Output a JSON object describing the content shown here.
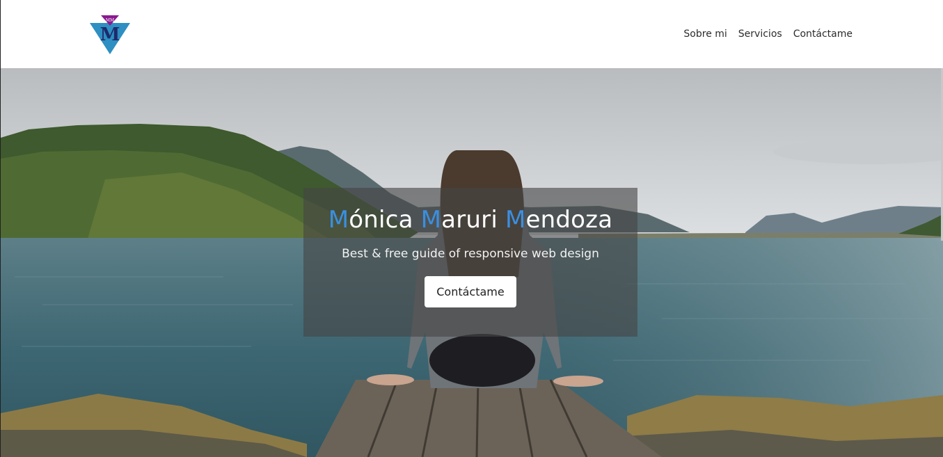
{
  "brand": {
    "logo_initials": "MM",
    "logo_letter": "M",
    "colors": {
      "triangle": "#2e8fc2",
      "top_triangle": "#8a1a8f",
      "letter": "#1d2a6b"
    }
  },
  "nav": {
    "items": [
      {
        "label": "Sobre mi"
      },
      {
        "label": "Servicios"
      },
      {
        "label": "Contáctame"
      }
    ]
  },
  "hero": {
    "title_parts": [
      {
        "initial": "M",
        "rest": "ónica"
      },
      {
        "initial": "M",
        "rest": "aruri"
      },
      {
        "initial": "M",
        "rest": "endoza"
      }
    ],
    "subtitle": "Best & free guide of responsive web design",
    "button_label": "Contáctame",
    "accent_color": "#3b8fe0"
  }
}
